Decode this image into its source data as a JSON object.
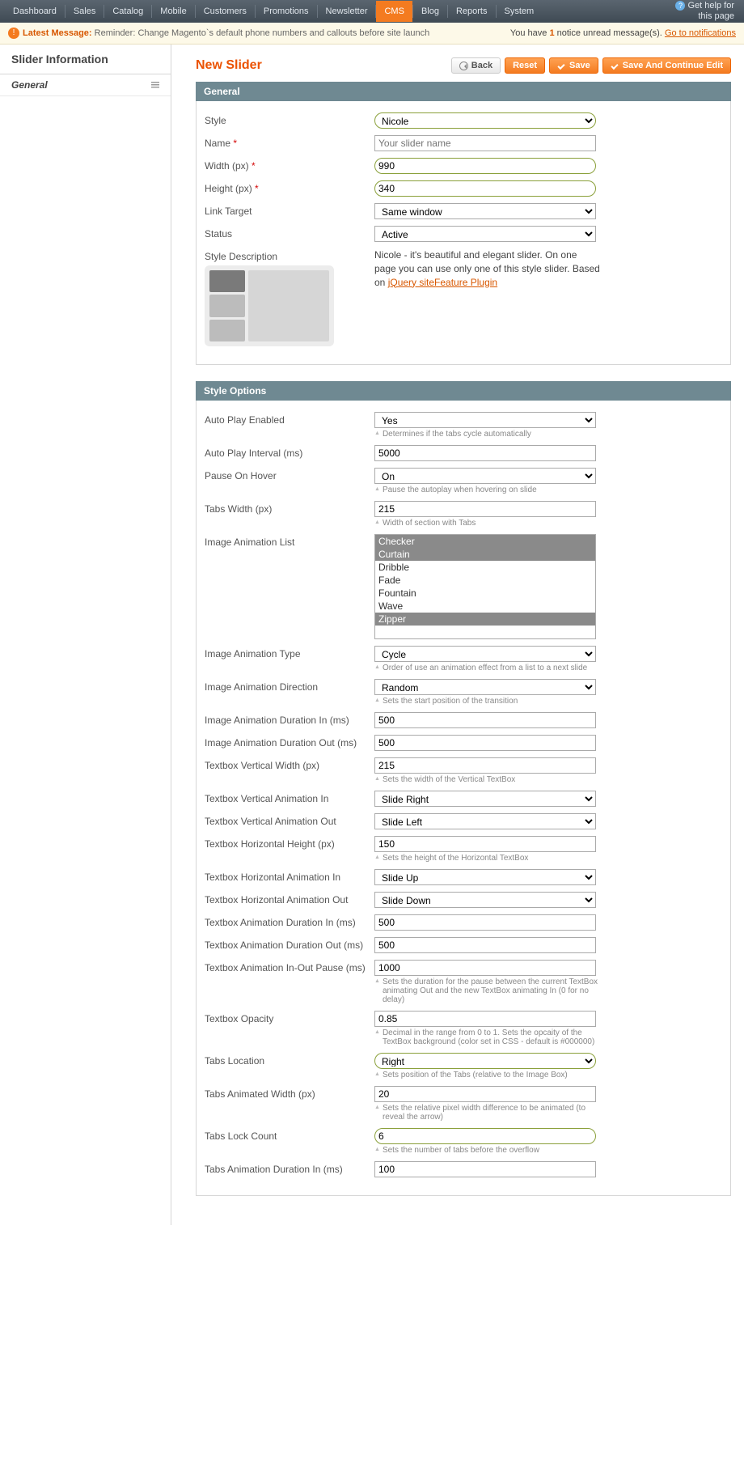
{
  "nav": {
    "items": [
      "Dashboard",
      "Sales",
      "Catalog",
      "Mobile",
      "Customers",
      "Promotions",
      "Newsletter",
      "CMS",
      "Blog",
      "Reports",
      "System"
    ],
    "active": "CMS",
    "help": "Get help for this page"
  },
  "notice": {
    "label": "Latest Message:",
    "text": "Reminder: Change Magento`s default phone numbers and callouts before site launch",
    "right_pre": "You have ",
    "right_count": "1",
    "right_post": " notice unread message(s). ",
    "right_link": "Go to notifications"
  },
  "side": {
    "title": "Slider Information",
    "tab": "General"
  },
  "header": {
    "title": "New Slider",
    "back": "Back",
    "reset": "Reset",
    "save": "Save",
    "save_cont": "Save And Continue Edit"
  },
  "general": {
    "title": "General",
    "style": {
      "label": "Style",
      "value": "Nicole"
    },
    "name": {
      "label": "Name",
      "placeholder": "Your slider name",
      "value": ""
    },
    "width": {
      "label": "Width (px)",
      "value": "990"
    },
    "height": {
      "label": "Height (px)",
      "value": "340"
    },
    "link": {
      "label": "Link Target",
      "value": "Same window"
    },
    "status": {
      "label": "Status",
      "value": "Active"
    },
    "desc_label": "Style Description",
    "desc_text": "Nicole - it's beautiful and elegant slider. On one page you can use only one of this style slider. Based on ",
    "desc_link": "jQuery siteFeature Plugin"
  },
  "opts": {
    "title": "Style Options",
    "autoplay": {
      "label": "Auto Play Enabled",
      "value": "Yes",
      "hint": "Determines if the tabs cycle automatically"
    },
    "interval": {
      "label": "Auto Play Interval (ms)",
      "value": "5000"
    },
    "pause": {
      "label": "Pause On Hover",
      "value": "On",
      "hint": "Pause the autoplay when hovering on slide"
    },
    "tabw": {
      "label": "Tabs Width (px)",
      "value": "215",
      "hint": "Width of section with Tabs"
    },
    "anim_list": {
      "label": "Image Animation List",
      "options": [
        "Checker",
        "Curtain",
        "Dribble",
        "Fade",
        "Fountain",
        "Wave",
        "Zipper"
      ],
      "selected": [
        "Checker",
        "Curtain",
        "Zipper"
      ]
    },
    "anim_type": {
      "label": "Image Animation Type",
      "value": "Cycle",
      "hint": "Order of use an animation effect from a list to a next slide"
    },
    "anim_dir": {
      "label": "Image Animation Direction",
      "value": "Random",
      "hint": "Sets the start position of the transition"
    },
    "anim_in": {
      "label": "Image Animation Duration In (ms)",
      "value": "500"
    },
    "anim_out": {
      "label": "Image Animation Duration Out (ms)",
      "value": "500"
    },
    "tbv_w": {
      "label": "Textbox Vertical Width (px)",
      "value": "215",
      "hint": "Sets the width of the Vertical TextBox"
    },
    "tbv_in": {
      "label": "Textbox Vertical Animation In",
      "value": "Slide Right"
    },
    "tbv_out": {
      "label": "Textbox Vertical Animation Out",
      "value": "Slide Left"
    },
    "tbh_h": {
      "label": "Textbox Horizontal Height (px)",
      "value": "150",
      "hint": "Sets the height of the Horizontal TextBox"
    },
    "tbh_in": {
      "label": "Textbox Horizontal Animation In",
      "value": "Slide Up"
    },
    "tbh_out": {
      "label": "Textbox Horizontal Animation Out",
      "value": "Slide Down"
    },
    "tb_din": {
      "label": "Textbox Animation Duration In (ms)",
      "value": "500"
    },
    "tb_dout": {
      "label": "Textbox Animation Duration Out (ms)",
      "value": "500"
    },
    "tb_pause": {
      "label": "Textbox Animation In-Out Pause (ms)",
      "value": "1000",
      "hint": "Sets the duration for the pause between the current TextBox animating Out and the new TextBox animating In (0 for no delay)"
    },
    "tb_opac": {
      "label": "Textbox Opacity",
      "value": "0.85",
      "hint": "Decimal in the range from 0 to 1. Sets the opcaity of the TextBox background (color set in CSS - default is #000000)"
    },
    "tabs_loc": {
      "label": "Tabs Location",
      "value": "Right",
      "hint": "Sets position of the Tabs (relative to the Image Box)"
    },
    "tabs_aw": {
      "label": "Tabs Animated Width (px)",
      "value": "20",
      "hint": "Sets the relative pixel width difference to be animated (to reveal the arrow)"
    },
    "tabs_lock": {
      "label": "Tabs Lock Count",
      "value": "6",
      "hint": "Sets the number of tabs before the overflow"
    },
    "tabs_adin": {
      "label": "Tabs Animation Duration In (ms)",
      "value": "100"
    }
  }
}
